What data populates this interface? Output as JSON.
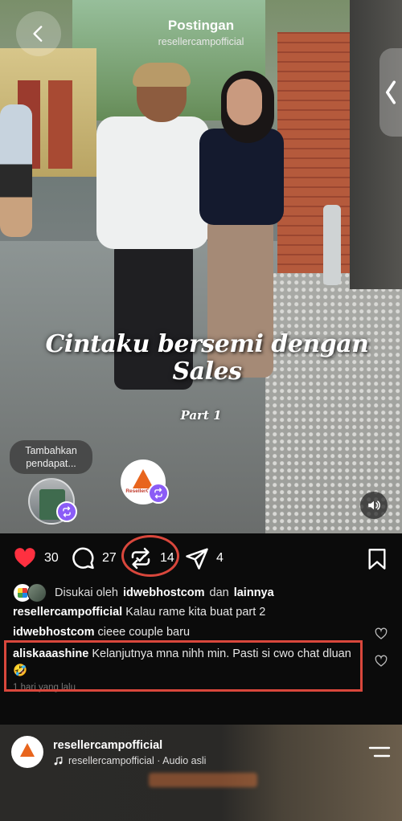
{
  "header": {
    "title": "Postingan",
    "subtitle": "resellercampofficial"
  },
  "video": {
    "caption_line1": "Cintaku bersemi dengan",
    "caption_line2": "Sales",
    "part_label": "Part 1",
    "note_bubble": "Tambahkan pendapat...",
    "logo_text": "ResellerCamp"
  },
  "actions": {
    "likes_count": "30",
    "comments_count": "27",
    "reposts_count": "14",
    "shares_count": "4"
  },
  "liked_by": {
    "prefix": "Disukai oleh",
    "user": "idwebhostcom",
    "middle": "dan",
    "others": "lainnya"
  },
  "comments": [
    {
      "user": "resellercampofficial",
      "text": "Kalau rame kita buat part 2"
    },
    {
      "user": "idwebhostcom",
      "text": "cieee couple baru"
    },
    {
      "user": "aliskaaashine",
      "text": "Kelanjutnya mna nihh min. Pasti si cwo chat dluan🤣",
      "time": "1 hari yang lalu"
    }
  ],
  "next_post": {
    "username": "resellercampofficial",
    "audio": "resellercampofficial · Audio asli"
  },
  "colors": {
    "highlight": "#d9473c",
    "like": "#ff3040",
    "repost_badge": "#8b5cf6"
  }
}
